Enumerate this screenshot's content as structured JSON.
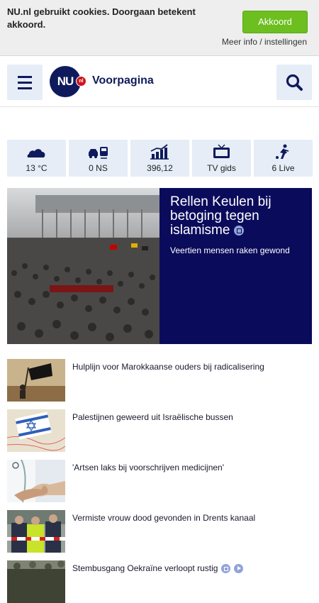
{
  "cookie_bar": {
    "message": "NU.nl gebruikt cookies. Doorgaan betekent akkoord.",
    "accept_label": "Akkoord",
    "more_link": "Meer info / instellingen"
  },
  "header": {
    "logo_text": "NU",
    "logo_badge": "nl",
    "title": "Voorpagina"
  },
  "tiles": [
    {
      "icon": "cloud-icon",
      "label": "13 °C"
    },
    {
      "icon": "car-train-icon",
      "label": "0 NS"
    },
    {
      "icon": "stock-chart-icon",
      "label": "396,12"
    },
    {
      "icon": "tv-icon",
      "label": "TV gids"
    },
    {
      "icon": "sports-player-icon",
      "label": "6 Live"
    }
  ],
  "hero": {
    "title": "Rellen Keulen bij betoging tegen islamisme",
    "subtitle": "Veertien mensen raken gewond"
  },
  "news": [
    {
      "title": "Hulplijn voor Marokkaanse ouders bij radicalisering"
    },
    {
      "title": "Palestijnen geweerd uit Israëlische bussen"
    },
    {
      "title": "'Artsen laks bij voorschrijven medicijnen'"
    },
    {
      "title": "Vermiste vrouw dood gevonden in Drents kanaal"
    },
    {
      "title": "Stembusgang Oekraïne verloopt rustig"
    }
  ],
  "colors": {
    "brand": "#0f1a5c",
    "accent_green": "#6cbf1f",
    "tile_bg": "#e6edf7",
    "hero_bg": "#0b0b5c"
  }
}
